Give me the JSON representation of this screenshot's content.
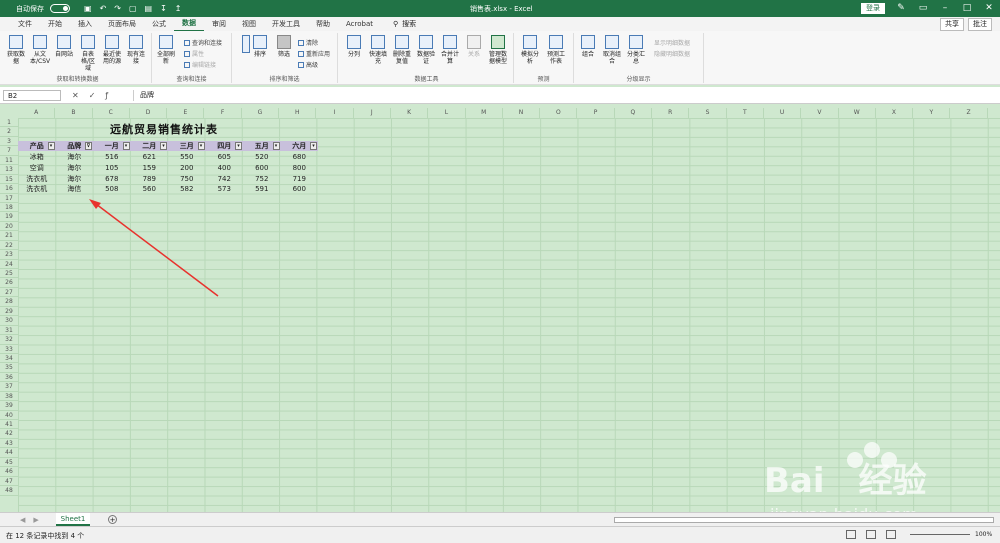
{
  "titlebar": {
    "autosave": "自动保存",
    "filename": "销售表.xlsx - Excel",
    "login": "登录"
  },
  "tabs": [
    "文件",
    "开始",
    "插入",
    "页面布局",
    "公式",
    "数据",
    "审阅",
    "视图",
    "开发工具",
    "帮助",
    "Acrobat"
  ],
  "active_tab": "数据",
  "search_label": "搜索",
  "share": "共享",
  "comment": "批注",
  "ribbon": {
    "g1": {
      "label": "获取和转换数据",
      "buttons": [
        "获取数据",
        "从文本/CSV",
        "自网站",
        "自表格/区域",
        "最近使用的源",
        "现有连接"
      ]
    },
    "g2": {
      "label": "查询和连接",
      "main": "全部刷新",
      "smalls": [
        "查询和连接",
        "属性",
        "编辑链接"
      ]
    },
    "g3": {
      "label": "排序和筛选",
      "sort": "排序",
      "filter": "筛选",
      "smalls": [
        "清除",
        "重新应用",
        "高级"
      ]
    },
    "g4": {
      "label": "数据工具",
      "buttons": [
        "分列",
        "快速填充",
        "删除重复值",
        "数据验证",
        "合并计算",
        "关系",
        "管理数据模型"
      ]
    },
    "g5": {
      "label": "预测",
      "buttons": [
        "模拟分析",
        "预测工作表"
      ]
    },
    "g6": {
      "label": "分级显示",
      "buttons": [
        "组合",
        "取消组合",
        "分类汇总"
      ],
      "smalls": [
        "显示明细数据",
        "隐藏明细数据"
      ]
    }
  },
  "formula": {
    "namebox": "B2",
    "content": "品牌"
  },
  "columns": [
    "A",
    "B",
    "C",
    "D",
    "E",
    "F",
    "G",
    "H",
    "I",
    "J",
    "K",
    "L",
    "M",
    "N",
    "O",
    "P",
    "Q",
    "R",
    "S",
    "T",
    "U",
    "V",
    "W",
    "X",
    "Y",
    "Z"
  ],
  "rows": [
    "1",
    "2",
    "3",
    "7",
    "11",
    "13",
    "15",
    "16",
    "17",
    "18",
    "19",
    "20",
    "21",
    "22",
    "23",
    "24",
    "25",
    "26",
    "27",
    "28",
    "29",
    "30",
    "31",
    "32",
    "33",
    "34",
    "35",
    "36",
    "37",
    "38",
    "39",
    "40",
    "41",
    "42",
    "43",
    "44",
    "45",
    "46",
    "47",
    "48"
  ],
  "sheet_title": "远航贸易销售统计表",
  "headers": [
    "产品",
    "品牌",
    "一月",
    "二月",
    "三月",
    "四月",
    "五月",
    "六月"
  ],
  "data_rows": [
    [
      "冰箱",
      "海尔",
      "516",
      "621",
      "550",
      "605",
      "520",
      "680"
    ],
    [
      "空调",
      "海尔",
      "105",
      "159",
      "200",
      "400",
      "600",
      "800"
    ],
    [
      "洗衣机",
      "海尔",
      "678",
      "789",
      "750",
      "742",
      "752",
      "719"
    ],
    [
      "洗衣机",
      "海信",
      "508",
      "560",
      "582",
      "573",
      "591",
      "600"
    ]
  ],
  "sheet_tab": "Sheet1",
  "status": "在 12 条记录中找到 4 个",
  "zoom": "100%",
  "watermark": "Baidu经验 jingyan.baidu.com"
}
